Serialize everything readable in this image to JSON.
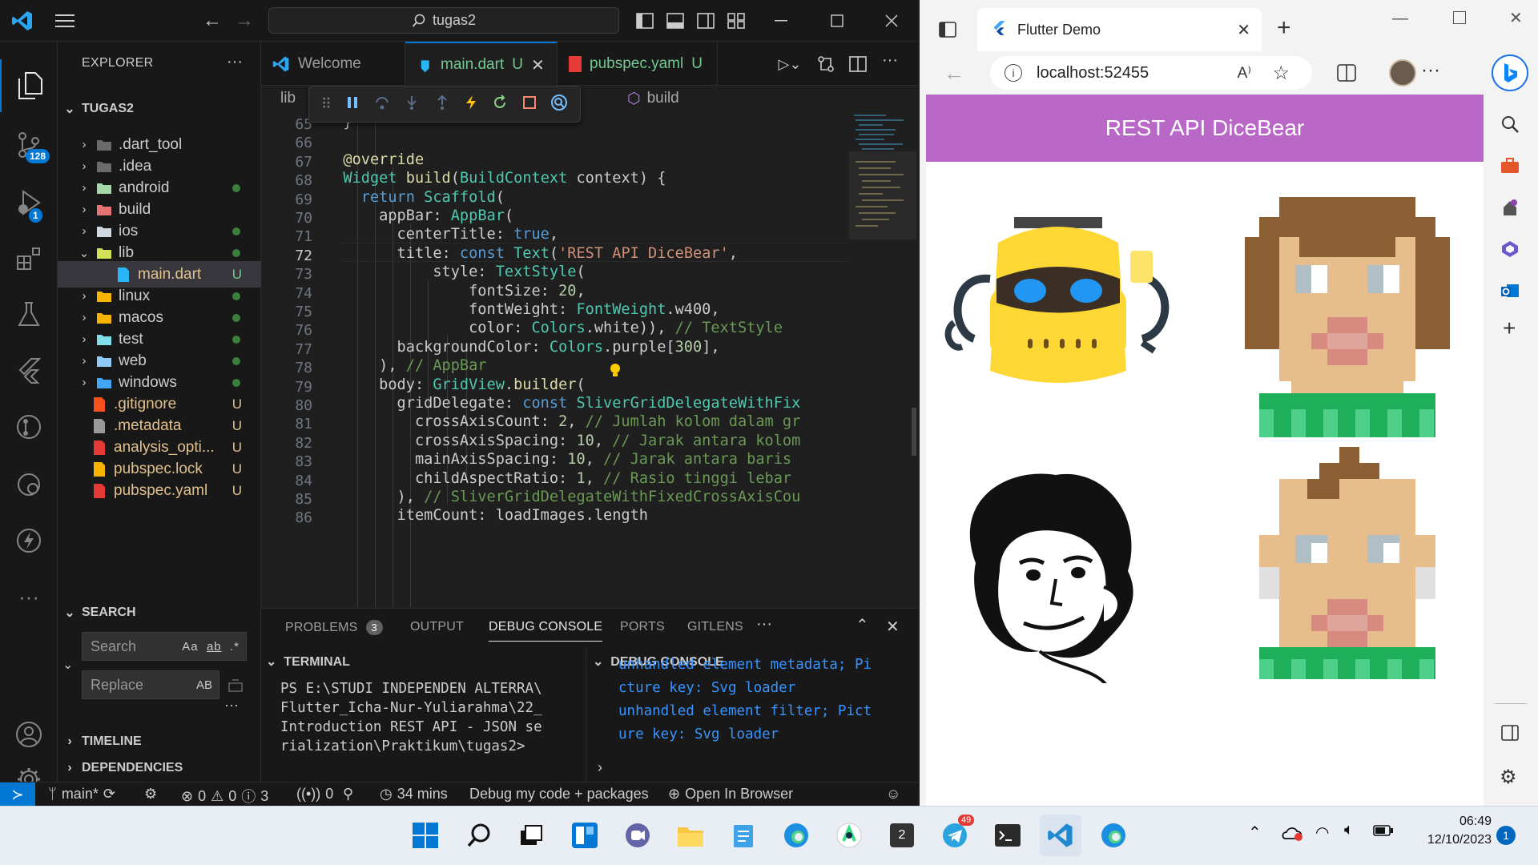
{
  "vscode": {
    "search_text": "tugas2",
    "tabs": [
      {
        "label": "Welcome"
      },
      {
        "label": "main.dart",
        "status": "U"
      },
      {
        "label": "pubspec.yaml",
        "status": "U"
      }
    ],
    "breadcrumb": {
      "first": "lib",
      "last": "build"
    },
    "activity_badges": {
      "source_control": "128",
      "run_debug": "1"
    },
    "explorer": {
      "title": "EXPLORER",
      "project": "TUGAS2",
      "items": [
        {
          "name": ".dart_tool",
          "type": "folder"
        },
        {
          "name": ".idea",
          "type": "folder"
        },
        {
          "name": "android",
          "type": "folder"
        },
        {
          "name": "build",
          "type": "folder"
        },
        {
          "name": "ios",
          "type": "folder"
        },
        {
          "name": "lib",
          "type": "folder"
        },
        {
          "name": "main.dart",
          "type": "file",
          "status": "U"
        },
        {
          "name": "linux",
          "type": "folder"
        },
        {
          "name": "macos",
          "type": "folder"
        },
        {
          "name": "test",
          "type": "folder"
        },
        {
          "name": "web",
          "type": "folder"
        },
        {
          "name": "windows",
          "type": "folder"
        },
        {
          "name": ".gitignore",
          "type": "file",
          "status": "U"
        },
        {
          "name": ".metadata",
          "type": "file",
          "status": "U"
        },
        {
          "name": "analysis_opti...",
          "type": "file",
          "status": "U"
        },
        {
          "name": "pubspec.lock",
          "type": "file",
          "status": "U"
        },
        {
          "name": "pubspec.yaml",
          "type": "file",
          "status": "U"
        }
      ]
    },
    "search": {
      "title": "SEARCH",
      "search_placeholder": "Search",
      "replace_placeholder": "Replace",
      "opt_case": "Aa",
      "opt_word": "ab",
      "opt_regex": ".*",
      "opt_preserve": "AB"
    },
    "timeline": "TIMELINE",
    "dependencies": "DEPENDENCIES",
    "line_numbers": [
      "65",
      "66",
      "67",
      "68",
      "69",
      "70",
      "71",
      "72",
      "73",
      "74",
      "75",
      "76",
      "77",
      "78",
      "79",
      "80",
      "81",
      "82",
      "83",
      "84",
      "85",
      "86"
    ],
    "code_lines": [
      "  }",
      "",
      "  @override",
      "  Widget build(BuildContext context) {",
      "    return Scaffold(",
      "      appBar: AppBar(",
      "        centerTitle: true,",
      "        title: const Text('REST API DiceBear',",
      "            style: TextStyle(",
      "                fontSize: 20,",
      "                fontWeight: FontWeight.w400,",
      "                color: Colors.white)), // TextStyle",
      "        backgroundColor: Colors.purple[300],",
      "      ), // AppBar",
      "      body: GridView.builder(",
      "        gridDelegate: const SliverGridDelegateWithFix",
      "          crossAxisCount: 2, // Jumlah kolom dalam gr",
      "          crossAxisSpacing: 10, // Jarak antara kolom",
      "          mainAxisSpacing: 10, // Jarak antara baris",
      "          childAspectRatio: 1, // Rasio tinggi lebar",
      "        ), // SliverGridDelegateWithFixedCrossAxisCou",
      "        itemCount: loadImages.length"
    ],
    "panel": {
      "tabs": [
        "PROBLEMS",
        "OUTPUT",
        "DEBUG CONSOLE",
        "PORTS",
        "GITLENS"
      ],
      "problems_count": "3",
      "terminal_title": "TERMINAL",
      "terminal_lines": [
        "PS E:\\STUDI INDEPENDEN ALTERRA\\",
        "Flutter_Icha-Nur-Yuliarahma\\22_",
        "Introduction REST API - JSON se",
        "rialization\\Praktikum\\tugas2>"
      ],
      "debug_title": "DEBUG CONSOLE",
      "debug_lines": [
        "unhandled element metadata; Pi",
        "cture key: Svg loader",
        "unhandled element filter; Pict",
        "ure key: Svg loader"
      ]
    },
    "statusbar": {
      "branch": "main*",
      "errors": "0",
      "warnings": "0",
      "info": "3",
      "ports": "0",
      "time": "34 mins",
      "debug_mode": "Debug my code + packages",
      "open_browser": "Open In Browser"
    }
  },
  "browser": {
    "tab_title": "Flutter Demo",
    "url": "localhost:52455",
    "app_title": "REST API DiceBear"
  },
  "taskbar": {
    "time": "06:49",
    "date": "12/10/2023",
    "telegram_badge": "49",
    "notif_count": "1",
    "desktop_badge": "2"
  }
}
